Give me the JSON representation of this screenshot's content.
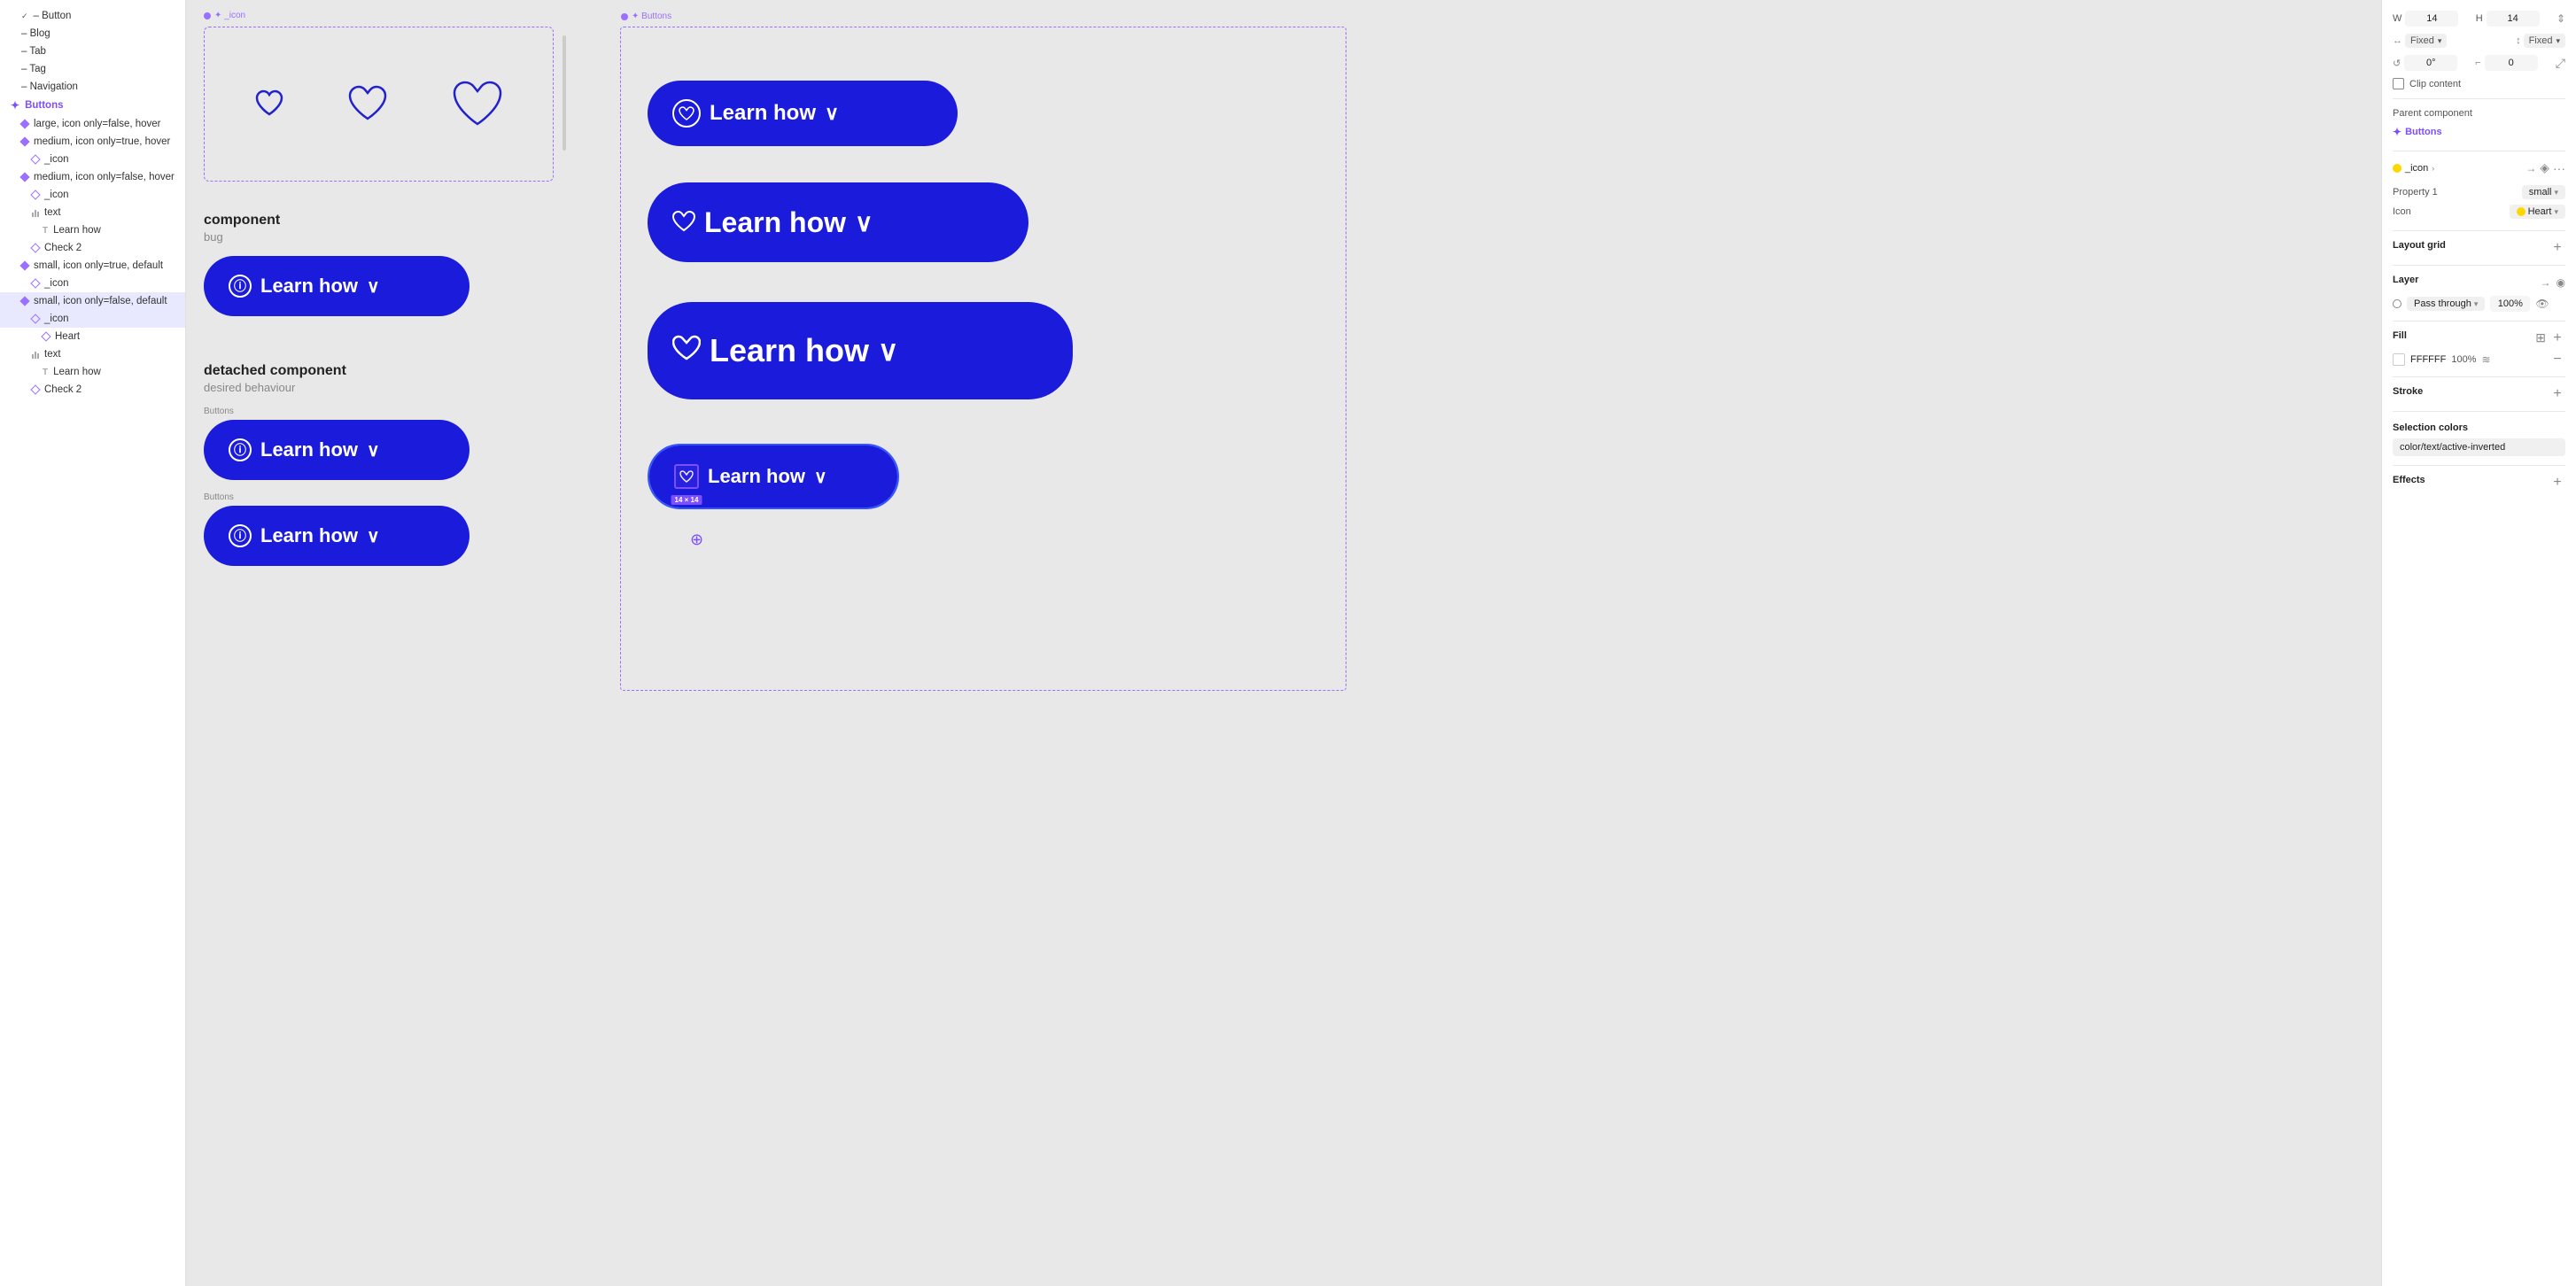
{
  "sidebar": {
    "items": [
      {
        "id": "button-header",
        "label": "– Button",
        "type": "chevron",
        "indent": 0,
        "selected": false
      },
      {
        "id": "blog",
        "label": "– Blog",
        "type": "plain",
        "indent": 0,
        "selected": false
      },
      {
        "id": "tab",
        "label": "– Tab",
        "type": "plain",
        "indent": 0,
        "selected": false
      },
      {
        "id": "tag",
        "label": "– Tag",
        "type": "plain",
        "indent": 0,
        "selected": false
      },
      {
        "id": "navigation",
        "label": "– Navigation",
        "type": "plain",
        "indent": 0,
        "selected": false
      },
      {
        "id": "buttons-section",
        "label": "Buttons",
        "type": "section",
        "indent": 0,
        "selected": false
      },
      {
        "id": "large-item",
        "label": "large, icon only=false, hover",
        "type": "diamond-fill",
        "indent": 1,
        "selected": false
      },
      {
        "id": "medium-icon-true",
        "label": "medium, icon only=true, hover",
        "type": "diamond-fill",
        "indent": 1,
        "selected": false
      },
      {
        "id": "icon1",
        "label": "_icon",
        "type": "diamond",
        "indent": 2,
        "selected": false
      },
      {
        "id": "medium-icon-false",
        "label": "medium, icon only=false, hover",
        "type": "diamond-fill",
        "indent": 1,
        "selected": false
      },
      {
        "id": "icon2",
        "label": "_icon",
        "type": "diamond",
        "indent": 2,
        "selected": false
      },
      {
        "id": "text1",
        "label": "text",
        "type": "bars",
        "indent": 2,
        "selected": false
      },
      {
        "id": "learnhow1",
        "label": "Learn how",
        "type": "T",
        "indent": 3,
        "selected": false
      },
      {
        "id": "check2-1",
        "label": "Check 2",
        "type": "diamond",
        "indent": 2,
        "selected": false
      },
      {
        "id": "small-icon-true",
        "label": "small, icon only=true, default",
        "type": "diamond-fill",
        "indent": 1,
        "selected": false
      },
      {
        "id": "icon3",
        "label": "_icon",
        "type": "diamond",
        "indent": 2,
        "selected": false
      },
      {
        "id": "small-icon-false",
        "label": "small, icon only=false, default",
        "type": "diamond-fill",
        "indent": 1,
        "selected": true
      },
      {
        "id": "icon4",
        "label": "_icon",
        "type": "diamond",
        "indent": 2,
        "selected": true
      },
      {
        "id": "heart",
        "label": "Heart",
        "type": "diamond",
        "indent": 3,
        "selected": false
      },
      {
        "id": "text2",
        "label": "text",
        "type": "bars",
        "indent": 2,
        "selected": false
      },
      {
        "id": "learnhow2",
        "label": "Learn how",
        "type": "T",
        "indent": 3,
        "selected": false
      },
      {
        "id": "check2-2",
        "label": "Check 2",
        "type": "diamond",
        "indent": 2,
        "selected": false
      }
    ]
  },
  "canvas": {
    "frame_icon_label": "✦ _icon",
    "frame_buttons_label": "✦ Buttons",
    "scrollbar_visible": true,
    "component_title": "component",
    "component_sub": "bug",
    "detached_title": "detached component",
    "detached_sub": "desired behaviour",
    "buttons_label_1": "Buttons",
    "buttons_label_2": "Buttons",
    "learn_how": "Learn how",
    "learn_how_2": "Learn how",
    "learn_how_3": "Learn how",
    "learn_how_4": "Learn how",
    "learn_how_5": "Learn how",
    "learn_how_6": "Learn how",
    "learn_how_7": "Learn how",
    "size_badge": "14 × 14"
  },
  "right_panel": {
    "w_label": "W",
    "w_value": "14",
    "h_label": "H",
    "h_value": "14",
    "width_type": "Fixed",
    "height_type": "Fixed",
    "rotation_label": "0°",
    "corner_label": "0",
    "clip_content_label": "Clip content",
    "parent_component_label": "Parent component",
    "parent_component_name": "Buttons",
    "icon_component_label": "_icon",
    "icon_component_chevron": "›",
    "property1_label": "Property 1",
    "property1_value": "small",
    "icon_label": "Icon",
    "icon_value": "Heart",
    "layout_grid_label": "Layout grid",
    "layer_label": "Layer",
    "passthrough_label": "Pass through",
    "passthrough_pct": "100%",
    "fill_label": "Fill",
    "fill_color": "FFFFFF",
    "fill_pct": "100%",
    "stroke_label": "Stroke",
    "selection_colors_label": "Selection colors",
    "selection_color_value": "color/text/active-inverted",
    "effects_label": "Effects"
  }
}
